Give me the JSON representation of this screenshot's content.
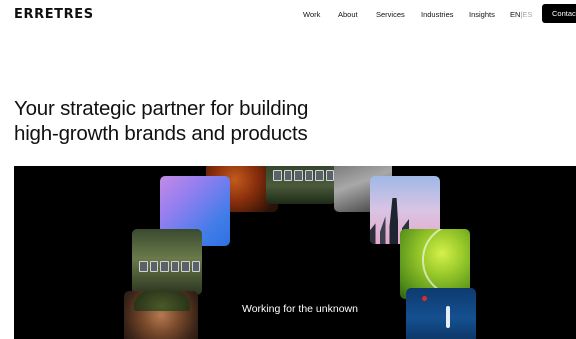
{
  "header": {
    "logo": "ERRETRES",
    "nav": [
      "Work",
      "About",
      "Services",
      "Industries",
      "Insights"
    ],
    "lang_active": "EN",
    "lang_sep": "|",
    "lang_inactive": "ES",
    "contact_label": "Contact"
  },
  "hero": {
    "headline_line1": "Your strategic partner for building",
    "headline_line2": "high-growth brands and products",
    "caption": "Working for the unknown"
  },
  "colors": {
    "accent": "#000000",
    "background": "#ffffff",
    "hero_background": "#000000"
  },
  "icons": [
    "solar-panel-image",
    "gradient-image",
    "city-skyline-image",
    "tennis-ball-image",
    "portrait-image",
    "boat-image"
  ]
}
